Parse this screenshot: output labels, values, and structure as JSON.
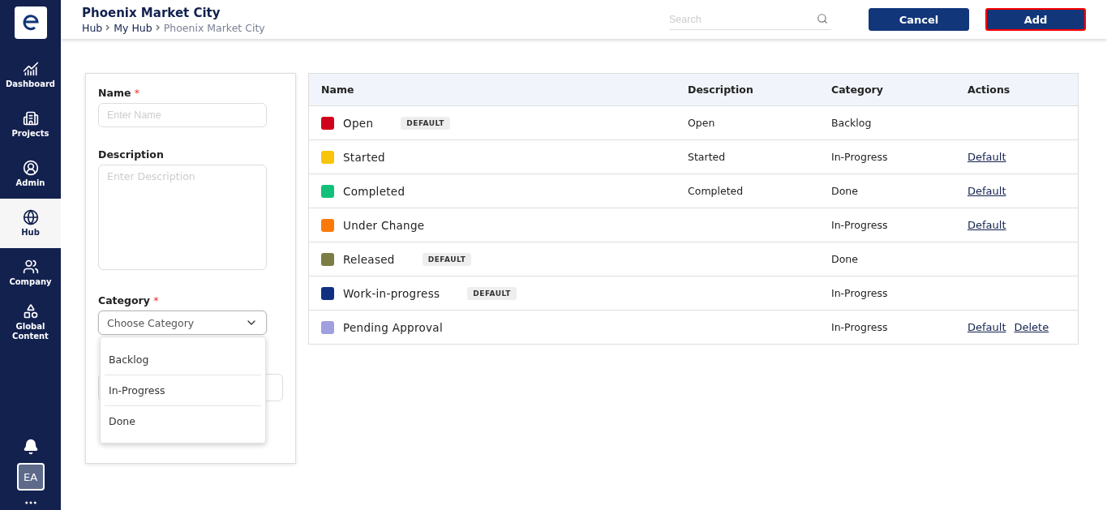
{
  "sidebar": {
    "items": [
      {
        "label": "Dashboard",
        "selected": false
      },
      {
        "label": "Projects",
        "selected": false
      },
      {
        "label": "Admin",
        "selected": false
      },
      {
        "label": "Hub",
        "selected": true
      },
      {
        "label": "Company",
        "selected": false
      },
      {
        "label": "Global Content",
        "selected": false
      }
    ],
    "avatar": "EA"
  },
  "header": {
    "title": "Phoenix Market City",
    "breadcrumb": [
      {
        "label": "Hub",
        "current": false
      },
      {
        "label": "My Hub",
        "current": false
      },
      {
        "label": "Phoenix Market City",
        "current": true
      }
    ],
    "search": {
      "placeholder": "Search"
    },
    "buttons": [
      {
        "label": "Cancel",
        "focused": false
      },
      {
        "label": "Add",
        "focused": true
      }
    ]
  },
  "form": {
    "name": {
      "label": "Name",
      "required_mark": "*",
      "placeholder": "Enter Name"
    },
    "description": {
      "label": "Description",
      "placeholder": "Enter Description"
    },
    "category": {
      "label": "Category",
      "required_mark": "*",
      "placeholder": "Choose Category",
      "expanded": true,
      "options": [
        "Backlog",
        "In-Progress",
        "Done"
      ]
    }
  },
  "table": {
    "columns": [
      "Name",
      "Description",
      "Category",
      "Actions"
    ],
    "rows": [
      {
        "name": "Open",
        "color": "#d0021b",
        "badge": "DEFAULT",
        "description": "Open",
        "category": "Backlog",
        "actions": []
      },
      {
        "name": "Started",
        "color": "#f8c40c",
        "description": "Started",
        "category": "In-Progress",
        "actions": [
          "Default"
        ]
      },
      {
        "name": "Completed",
        "color": "#13c07a",
        "description": "Completed",
        "category": "Done",
        "actions": [
          "Default"
        ]
      },
      {
        "name": "Under Change",
        "color": "#f97a0b",
        "category": "In-Progress",
        "actions": [
          "Default"
        ]
      },
      {
        "name": "Released",
        "color": "#7b7d44",
        "badge": "DEFAULT",
        "category": "Done",
        "actions": []
      },
      {
        "name": "Work-in-progress",
        "color": "#10307f",
        "badge": "DEFAULT",
        "category": "In-Progress",
        "actions": []
      },
      {
        "name": "Pending Approval",
        "color": "#a09fe0",
        "category": "In-Progress",
        "actions": [
          "Default",
          "Delete"
        ]
      }
    ]
  }
}
